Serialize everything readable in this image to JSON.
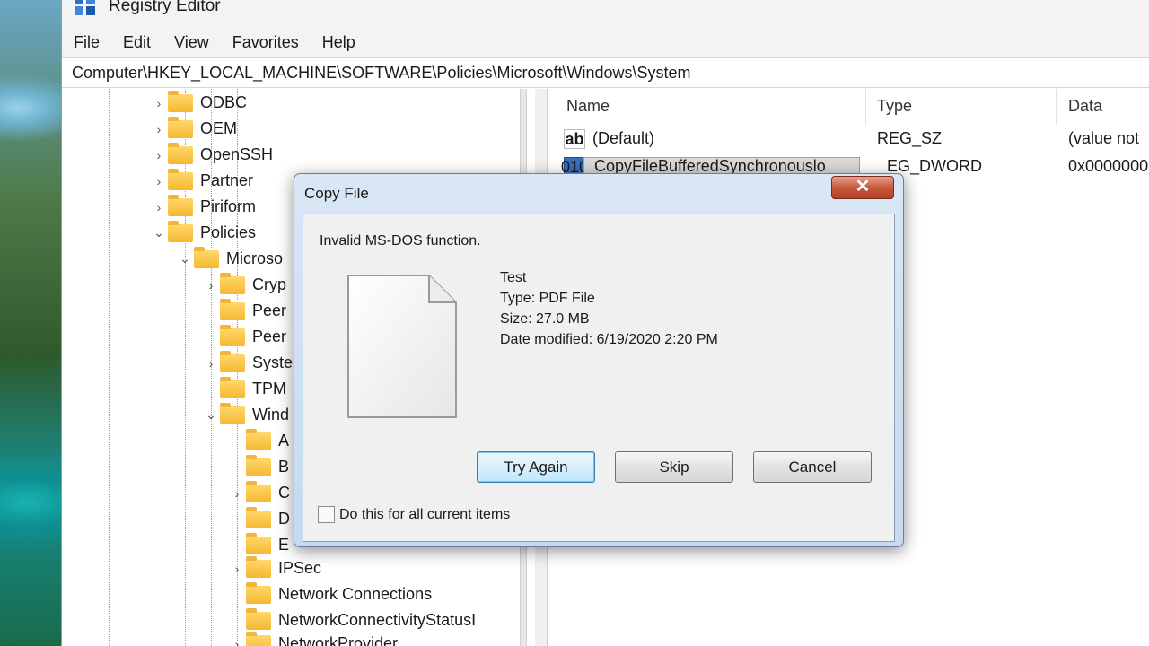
{
  "window": {
    "title": "Registry Editor",
    "menu": [
      "File",
      "Edit",
      "View",
      "Favorites",
      "Help"
    ],
    "address": "Computer\\HKEY_LOCAL_MACHINE\\SOFTWARE\\Policies\\Microsoft\\Windows\\System"
  },
  "tree": {
    "items": [
      {
        "label": "ODBC",
        "expander": "›"
      },
      {
        "label": "OEM",
        "expander": "›"
      },
      {
        "label": "OpenSSH",
        "expander": "›"
      },
      {
        "label": "Partner",
        "expander": "›"
      },
      {
        "label": "Piriform",
        "expander": "›"
      },
      {
        "label": "Policies",
        "expander": "⌄"
      },
      {
        "label": "Microso",
        "expander": "⌄"
      },
      {
        "label": "Cryp",
        "expander": "›"
      },
      {
        "label": "Peer",
        "expander": ""
      },
      {
        "label": "Peer",
        "expander": ""
      },
      {
        "label": "Syste",
        "expander": "›"
      },
      {
        "label": "TPM",
        "expander": ""
      },
      {
        "label": "Wind",
        "expander": "⌄"
      },
      {
        "label": "A",
        "expander": ""
      },
      {
        "label": "B",
        "expander": ""
      },
      {
        "label": "C",
        "expander": "›"
      },
      {
        "label": "D",
        "expander": ""
      },
      {
        "label": "E",
        "expander": ""
      },
      {
        "label": "IPSec",
        "expander": "›"
      },
      {
        "label": "Network Connections",
        "expander": ""
      },
      {
        "label": "NetworkConnectivityStatusI",
        "expander": ""
      },
      {
        "label": "NetworkProvider",
        "expander": "›"
      }
    ]
  },
  "values": {
    "columns": {
      "name": "Name",
      "type": "Type",
      "data": "Data"
    },
    "rows": [
      {
        "icon": "string-value-icon",
        "icon_text": "ab",
        "name": "(Default)",
        "type": "REG_SZ",
        "data": "(value not"
      },
      {
        "icon": "dword-value-icon",
        "icon_text": "010",
        "name": "CopyFileBufferedSynchronouslo",
        "type": "EG_DWORD",
        "data": "0x0000000"
      }
    ]
  },
  "dialog": {
    "title": "Copy File",
    "close_glyph": "✕",
    "message": "Invalid MS-DOS function.",
    "file": {
      "name": "Test",
      "type": "Type: PDF File",
      "size": "Size: 27.0 MB",
      "modified": "Date modified: 6/19/2020 2:20 PM"
    },
    "buttons": {
      "try_again": "Try Again",
      "skip": "Skip",
      "cancel": "Cancel"
    },
    "checkbox_label": "Do this for all current items",
    "checkbox_checked": false
  },
  "colors": {
    "dialog_frame": "#c6d9ef",
    "close_button": "#c75a3f",
    "default_button_border": "#3c7fb1",
    "folder": "#f5b731"
  }
}
